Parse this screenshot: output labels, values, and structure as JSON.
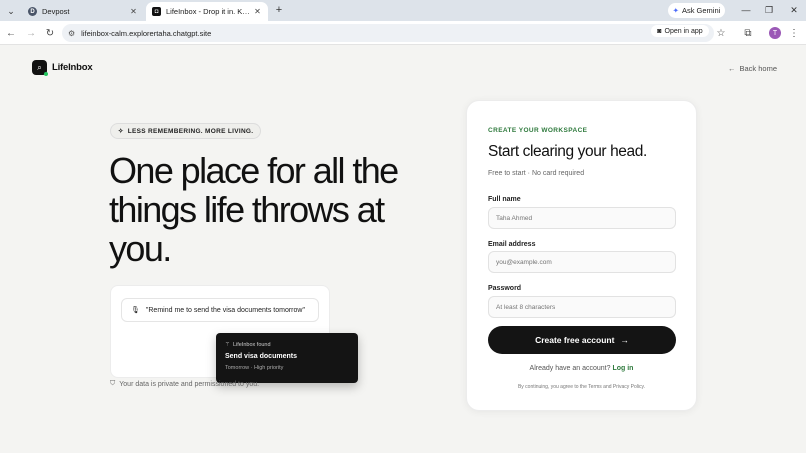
{
  "browser": {
    "tabs": [
      {
        "title": "Devpost",
        "favicon": "devpost-icon",
        "active": false
      },
      {
        "title": "LifeInbox - Drop it in. Know what...",
        "favicon": "lifeinbox-icon",
        "active": true
      }
    ],
    "gemini_label": "Ask Gemini",
    "url": "lifeinbox-calm.explorertaha.chatgpt.site",
    "open_in_app": "Open in app",
    "profile_initial": "T"
  },
  "header": {
    "brand_name": "LifeInbox",
    "back_home": "Back home"
  },
  "hero": {
    "pill_text": "LESS REMEMBERING. MORE LIVING.",
    "headline": "One place for all the things life throws at you."
  },
  "demo": {
    "voice_text": "\"Remind me to send the visa documents tomorrow\"",
    "toast_found": "LifeInbox found",
    "toast_title": "Send visa documents",
    "toast_meta": "Tomorrow · High priority",
    "privacy_text": "Your data is private and permissioned to you."
  },
  "signup": {
    "eyebrow": "CREATE YOUR WORKSPACE",
    "title": "Start clearing your head.",
    "subtitle": "Free to start · No card required",
    "fields": {
      "name_label": "Full name",
      "name_placeholder": "Taha Ahmed",
      "email_label": "Email address",
      "email_placeholder": "you@example.com",
      "password_label": "Password",
      "password_placeholder": "At least 8 characters"
    },
    "cta_label": "Create free account",
    "login_prompt": "Already have an account?",
    "login_link": "Log in",
    "terms": "By continuing, you agree to the Terms and Privacy Policy."
  },
  "colors": {
    "accent_green": "#2f7a3d",
    "dark": "#141414",
    "page_bg": "#f4f4f2"
  }
}
